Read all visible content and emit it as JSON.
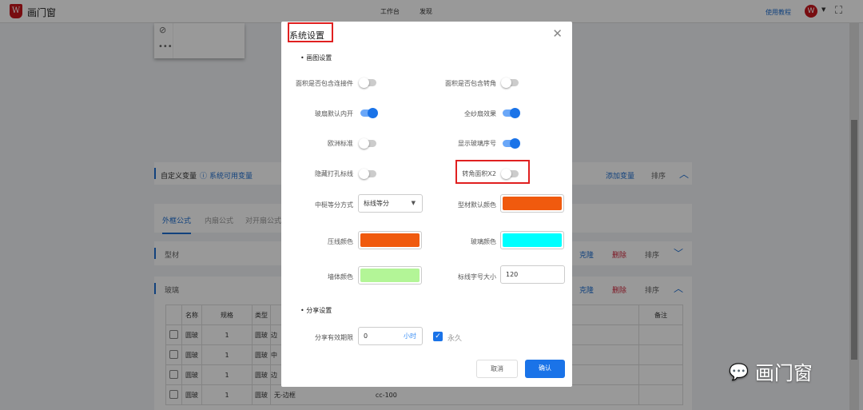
{
  "header": {
    "brand": "画门窗",
    "nav": [
      "工作台",
      "发现"
    ],
    "tutorial": "使用教程",
    "avatar_letter": "W"
  },
  "background": {
    "custom_vars": "自定义变量",
    "sys_vars": "系统可用变量",
    "add_var": "添加变量",
    "sort": "排序",
    "tabs": [
      "外框公式",
      "内扇公式",
      "对开扇公式"
    ],
    "profile_section": "型材",
    "glass_section": "玻璃",
    "clone": "克隆",
    "delete": "删除",
    "table": {
      "headers": [
        "",
        "名称",
        "规格",
        "类型",
        "",
        "备注"
      ],
      "rows": [
        [
          "圆玻",
          "1",
          "圆玻",
          "边",
          ""
        ],
        [
          "圆玻",
          "1",
          "圆玻",
          "中",
          ""
        ],
        [
          "圆玻",
          "1",
          "圆玻",
          "边",
          ""
        ],
        [
          "圆玻",
          "1",
          "圆玻",
          "无-边框",
          "cc-100"
        ]
      ]
    }
  },
  "watermark": "画门窗",
  "modal": {
    "title": "系统设置",
    "drawing_section": "画图设置",
    "toggles": [
      {
        "label": "面积是否包含连接件",
        "on": false
      },
      {
        "label": "面积是否包含转角",
        "on": false
      },
      {
        "label": "玻扇默认内开",
        "on": true
      },
      {
        "label": "全纱扇效果",
        "on": true
      },
      {
        "label": "欧洲标准",
        "on": false
      },
      {
        "label": "显示玻璃序号",
        "on": true
      },
      {
        "label": "隐藏打孔标线",
        "on": false
      },
      {
        "label": "转角面积X2",
        "on": false
      }
    ],
    "mullion_split": {
      "label": "中梃等分方式",
      "value": "标线等分"
    },
    "profile_color": {
      "label": "型材默认颜色",
      "color": "#f05a0e"
    },
    "bead_color": {
      "label": "压线颜色",
      "color": "#f05a0e"
    },
    "glass_color": {
      "label": "玻璃颜色",
      "color": "#00ffff"
    },
    "wall_color": {
      "label": "墙体颜色",
      "color": "#b3f597"
    },
    "dim_font": {
      "label": "标线字号大小",
      "value": "120"
    },
    "share_section": "分享设置",
    "share_valid": {
      "label": "分享有效期限",
      "value": "0",
      "unit": "小时"
    },
    "forever": {
      "label": "永久",
      "checked": true
    },
    "cancel": "取消",
    "confirm": "确认"
  }
}
